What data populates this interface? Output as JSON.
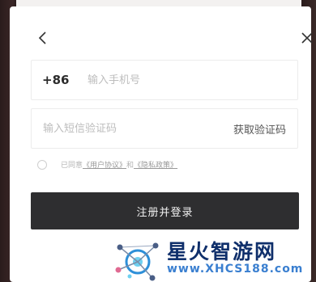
{
  "dialog": {
    "back_icon": "chevron-left-icon",
    "close_icon": "close-icon",
    "phone": {
      "prefix": "+86",
      "placeholder": "输入手机号"
    },
    "code": {
      "placeholder": "输入短信验证码",
      "get_code_label": "获取验证码"
    },
    "agreement": {
      "prefix": "已同意",
      "user_agreement": "《用户协议》",
      "and": "和",
      "privacy_policy": "《隐私政策》"
    },
    "submit_label": "注册并登录"
  },
  "watermark": {
    "title": "星火智游网",
    "url": "www.XHCS188.com"
  },
  "colors": {
    "button_bg": "#2e2e30",
    "watermark_title": "#0f2f6b",
    "watermark_url": "#3a7fd0"
  }
}
